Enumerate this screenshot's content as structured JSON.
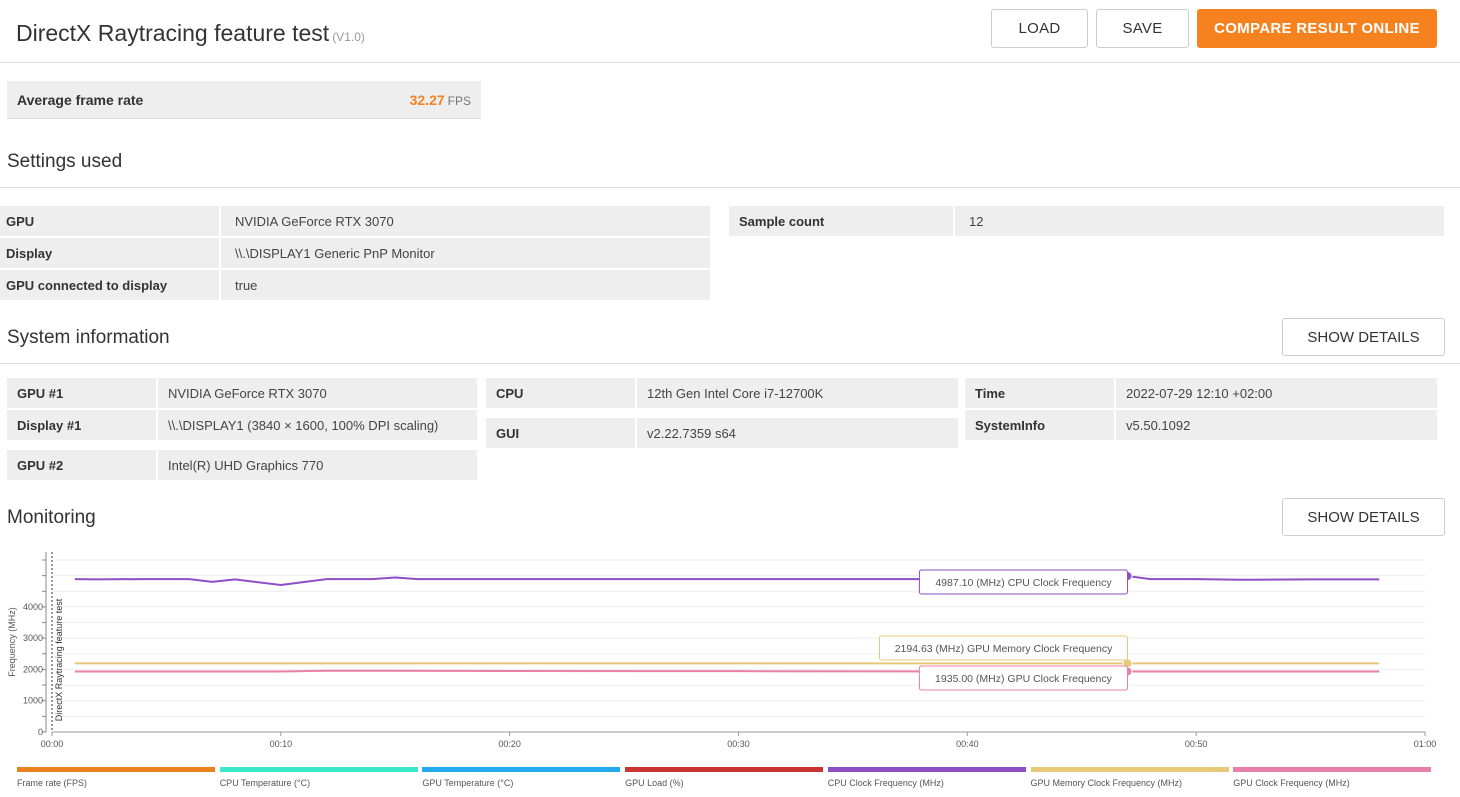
{
  "header": {
    "title": "DirectX Raytracing feature test",
    "version": "(V1.0)",
    "load_label": "LOAD",
    "save_label": "SAVE",
    "compare_label": "COMPARE RESULT ONLINE"
  },
  "result": {
    "label": "Average frame rate",
    "value": "32.27",
    "unit": "FPS"
  },
  "settings": {
    "title": "Settings used",
    "rows": [
      {
        "key": "GPU",
        "value": "NVIDIA GeForce RTX 3070"
      },
      {
        "key": "Display",
        "value": "\\\\.\\DISPLAY1 Generic PnP Monitor"
      },
      {
        "key": "GPU connected to display",
        "value": "true"
      }
    ],
    "sample": {
      "key": "Sample count",
      "value": "12"
    }
  },
  "system": {
    "title": "System information",
    "show_details": "SHOW DETAILS",
    "col1": [
      {
        "key": "GPU #1",
        "value": "NVIDIA GeForce RTX 3070"
      },
      {
        "key": "Display #1",
        "value": "\\\\.\\DISPLAY1 (3840 × 1600, 100% DPI scaling)"
      },
      {
        "key": "GPU #2",
        "value": "Intel(R) UHD Graphics 770"
      }
    ],
    "col2": [
      {
        "key": "CPU",
        "value": "12th Gen Intel Core i7-12700K"
      },
      {
        "key": "GUI",
        "value": "v2.22.7359 s64"
      }
    ],
    "col3": [
      {
        "key": "Time",
        "value": "2022-07-29 12:10 +02:00"
      },
      {
        "key": "SystemInfo",
        "value": "v5.50.1092"
      }
    ]
  },
  "monitoring": {
    "title": "Monitoring",
    "show_details": "SHOW DETAILS",
    "tooltips": [
      {
        "text": "4987.10 (MHz) CPU Clock Frequency",
        "color": "#8e4ec6"
      },
      {
        "text": "2194.63 (MHz) GPU Memory Clock Frequency",
        "color": "#e8c877"
      },
      {
        "text": "1935.00 (MHz) GPU Clock Frequency",
        "color": "#e87fa8"
      }
    ],
    "legend": [
      {
        "label": "Frame rate (FPS)",
        "color": "#e8821f"
      },
      {
        "label": "CPU Temperature (°C)",
        "color": "#3be8c8"
      },
      {
        "label": "GPU Temperature (°C)",
        "color": "#22aaee"
      },
      {
        "label": "GPU Load (%)",
        "color": "#cc3333"
      },
      {
        "label": "CPU Clock Frequency (MHz)",
        "color": "#8e4ec6"
      },
      {
        "label": "GPU Memory Clock Frequency (MHz)",
        "color": "#e8c877"
      },
      {
        "label": "GPU Clock Frequency (MHz)",
        "color": "#e87fa8"
      }
    ]
  },
  "chart_data": {
    "type": "line",
    "ylabel": "Frequency (MHz)",
    "vertical_marker_label": "DirectX Raytracing feature test",
    "x_ticks": [
      "00:00",
      "00:10",
      "00:20",
      "00:30",
      "00:40",
      "00:50",
      "01:00"
    ],
    "y_ticks": [
      "0",
      "1000",
      "2000",
      "3000",
      "4000"
    ],
    "xlim_seconds": [
      0,
      60
    ],
    "ylim": [
      0,
      5500
    ],
    "series": [
      {
        "name": "CPU Clock Frequency (MHz)",
        "color": "#8e4ec6",
        "x": [
          1,
          2,
          4,
          6,
          7,
          8,
          10,
          12,
          14,
          15,
          16,
          20,
          30,
          40,
          46,
          47,
          48,
          50,
          52,
          55,
          58
        ],
        "y": [
          4890,
          4880,
          4890,
          4890,
          4800,
          4880,
          4700,
          4890,
          4890,
          4940,
          4890,
          4890,
          4890,
          4890,
          4890,
          4987,
          4890,
          4890,
          4870,
          4880,
          4880
        ]
      },
      {
        "name": "GPU Memory Clock Frequency (MHz)",
        "color": "#e8c877",
        "x": [
          1,
          10,
          20,
          30,
          40,
          47,
          58
        ],
        "y": [
          2194,
          2194,
          2194,
          2194,
          2194,
          2194,
          2194
        ]
      },
      {
        "name": "GPU Clock Frequency (MHz)",
        "color": "#e87fa8",
        "x": [
          1,
          10,
          12,
          20,
          30,
          40,
          47,
          58
        ],
        "y": [
          1935,
          1935,
          1960,
          1950,
          1945,
          1935,
          1935,
          1935
        ]
      }
    ],
    "marker_x": 47
  }
}
